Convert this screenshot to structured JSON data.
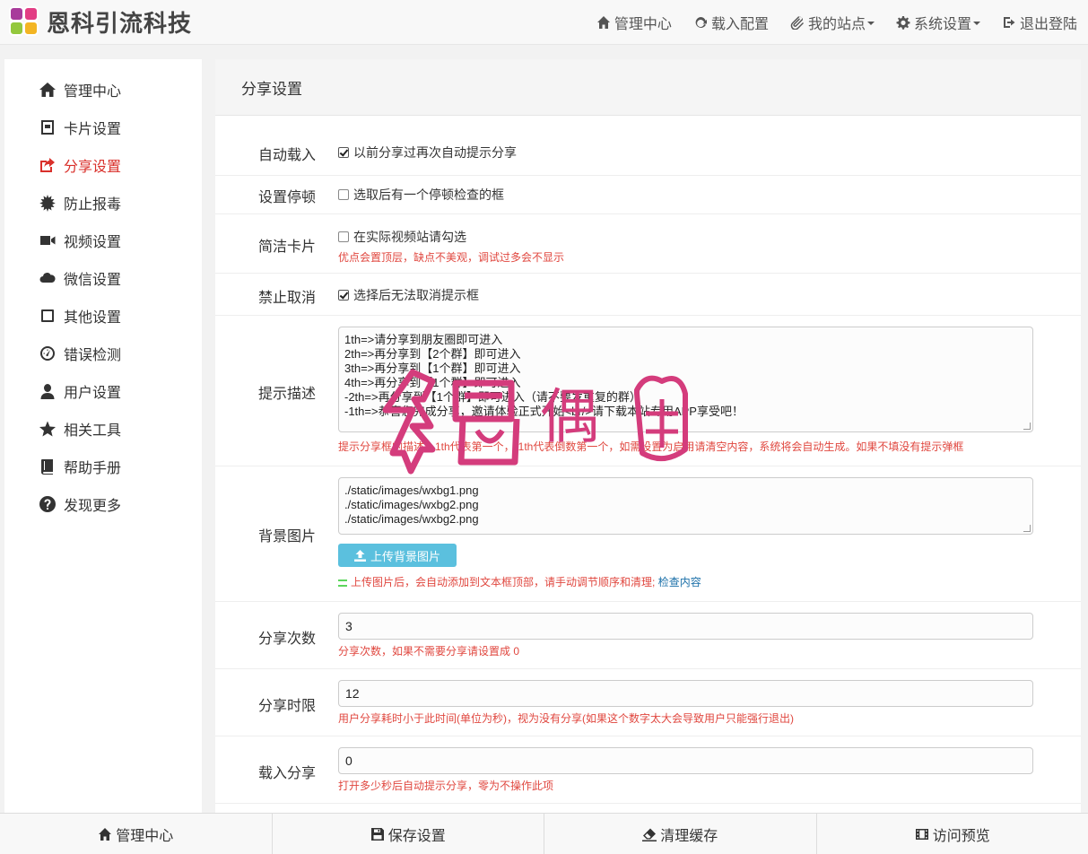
{
  "brand": {
    "title": "恩科引流科技"
  },
  "nav": {
    "home": "管理中心",
    "load_config": "载入配置",
    "my_sites": "我的站点",
    "system_settings": "系统设置",
    "logout": "退出登陆"
  },
  "sidebar": {
    "items": [
      {
        "label": "管理中心",
        "icon": "home-icon"
      },
      {
        "label": "卡片设置",
        "icon": "card-icon"
      },
      {
        "label": "分享设置",
        "icon": "share-icon",
        "active": true
      },
      {
        "label": "防止报毒",
        "icon": "virus-icon"
      },
      {
        "label": "视频设置",
        "icon": "video-icon"
      },
      {
        "label": "微信设置",
        "icon": "cloud-icon"
      },
      {
        "label": "其他设置",
        "icon": "square-icon"
      },
      {
        "label": "错误检测",
        "icon": "dashboard-icon"
      },
      {
        "label": "用户设置",
        "icon": "user-icon"
      },
      {
        "label": "相关工具",
        "icon": "star-icon"
      },
      {
        "label": "帮助手册",
        "icon": "book-icon"
      },
      {
        "label": "发现更多",
        "icon": "question-icon"
      }
    ]
  },
  "panel": {
    "title": "分享设置",
    "auto_load": {
      "label": "自动载入",
      "checkbox": "以前分享过再次自动提示分享",
      "checked": true
    },
    "pause": {
      "label": "设置停顿",
      "checkbox": "选取后有一个停顿检查的框",
      "checked": false
    },
    "simple_card": {
      "label": "简洁卡片",
      "checkbox": "在实际视频站请勾选",
      "checked": false,
      "hint": "优点会置顶层，缺点不美观，调试过多会不显示"
    },
    "no_cancel": {
      "label": "禁止取消",
      "checkbox": "选择后无法取消提示框",
      "checked": true
    },
    "prompt": {
      "label": "提示描述",
      "value": "1th=>请分享到朋友圈即可进入\n2th=>再分享到【2个群】即可进入\n3th=>再分享到【1个群】即可进入\n4th=>再分享到【1个群】即可进入\n-2th=>再分享到【1个群】即可进入（请不要发重复的群）\n-1th=>恭喜您完成分享，邀请体验正式开始<br/>请下载本站专用APP享受吧！",
      "hint": "提示分享框的描述，1th代表第一个，-1th代表倒数第一个，如需设置为启用请清空内容，系统将会自动生成。如果不填没有提示弹框"
    },
    "background": {
      "label": "背景图片",
      "value": "./static/images/wxbg1.png\n./static/images/wxbg2.png\n./static/images/wxbg2.png",
      "upload": "上传背景图片",
      "hint": "上传图片后，会自动添加到文本框顶部，请手动调节顺序和清理;",
      "hint_link": "检查内容"
    },
    "share_count": {
      "label": "分享次数",
      "value": "3",
      "hint": "分享次数，如果不需要分享请设置成 0"
    },
    "share_time": {
      "label": "分享时限",
      "value": "12",
      "hint": "用户分享耗时小于此时间(单位为秒)，视为没有分享(如果这个数字太大会导致用户只能强行退出)"
    },
    "load_share": {
      "label": "载入分享",
      "value": "0",
      "hint": "打开多少秒后自动提示分享，零为不操作此项"
    }
  },
  "watermark": {
    "text": "偶"
  },
  "bottom": {
    "home": "管理中心",
    "save": "保存设置",
    "clear": "清理缓存",
    "preview": "访问预览"
  }
}
